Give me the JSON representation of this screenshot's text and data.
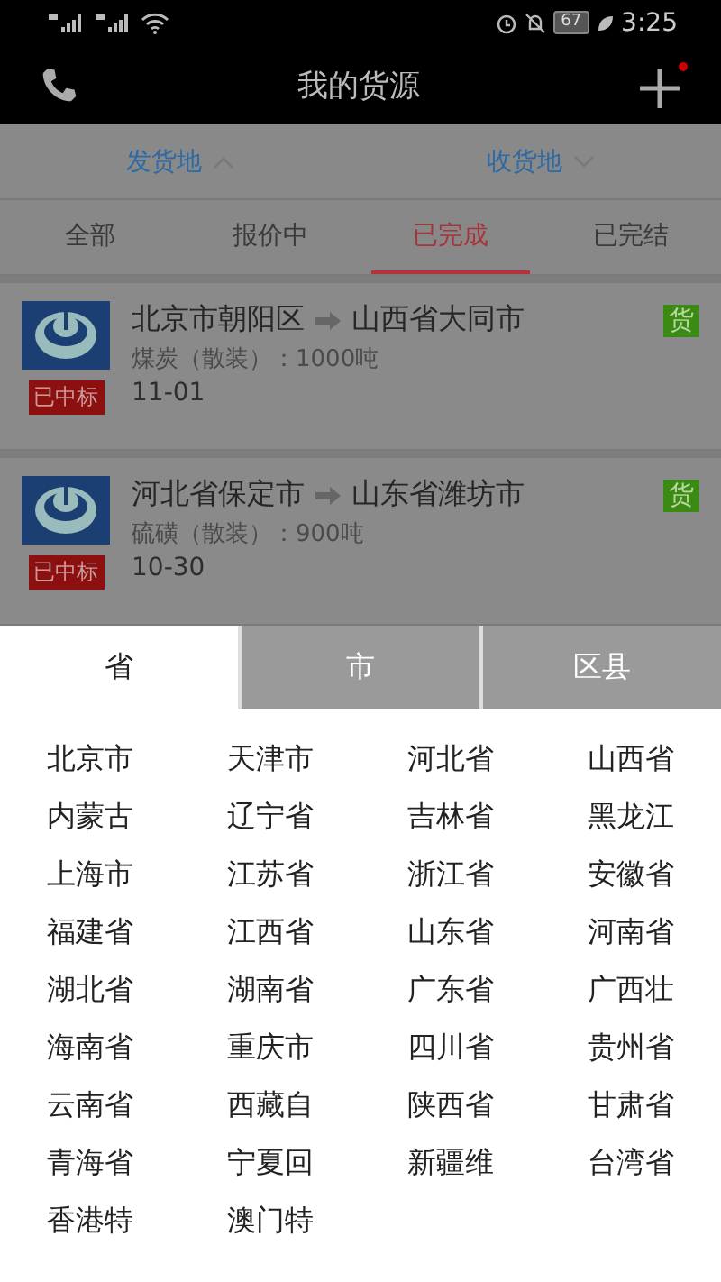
{
  "status_bar": {
    "battery": "67",
    "time": "3:25"
  },
  "header": {
    "title": "我的货源",
    "has_notification": true
  },
  "filters": [
    {
      "label": "发货地",
      "expanded": true
    },
    {
      "label": "收货地",
      "expanded": false
    }
  ],
  "tabs": [
    {
      "label": "全部",
      "selected": false
    },
    {
      "label": "报价中",
      "selected": false
    },
    {
      "label": "已完成",
      "selected": true
    },
    {
      "label": "已完结",
      "selected": false
    }
  ],
  "orders": [
    {
      "from": "北京市朝阳区",
      "to": "山西省大同市",
      "badge": "货",
      "cargo": "煤炭（散装）：1000吨",
      "status": "已中标",
      "date": "11-01"
    },
    {
      "from": "河北省保定市",
      "to": "山东省潍坊市",
      "badge": "货",
      "cargo": "硫磺（散装）：900吨",
      "status": "已中标",
      "date": "10-30"
    }
  ],
  "picker": {
    "tabs": [
      {
        "label": "省",
        "selected": true
      },
      {
        "label": "市",
        "selected": false
      },
      {
        "label": "区县",
        "selected": false
      }
    ],
    "items": [
      "北京市",
      "天津市",
      "河北省",
      "山西省",
      "内蒙古",
      "辽宁省",
      "吉林省",
      "黑龙江",
      "上海市",
      "江苏省",
      "浙江省",
      "安徽省",
      "福建省",
      "江西省",
      "山东省",
      "河南省",
      "湖北省",
      "湖南省",
      "广东省",
      "广西壮",
      "海南省",
      "重庆市",
      "四川省",
      "贵州省",
      "云南省",
      "西藏自",
      "陕西省",
      "甘肃省",
      "青海省",
      "宁夏回",
      "新疆维",
      "台湾省",
      "香港特",
      "澳门特"
    ]
  }
}
